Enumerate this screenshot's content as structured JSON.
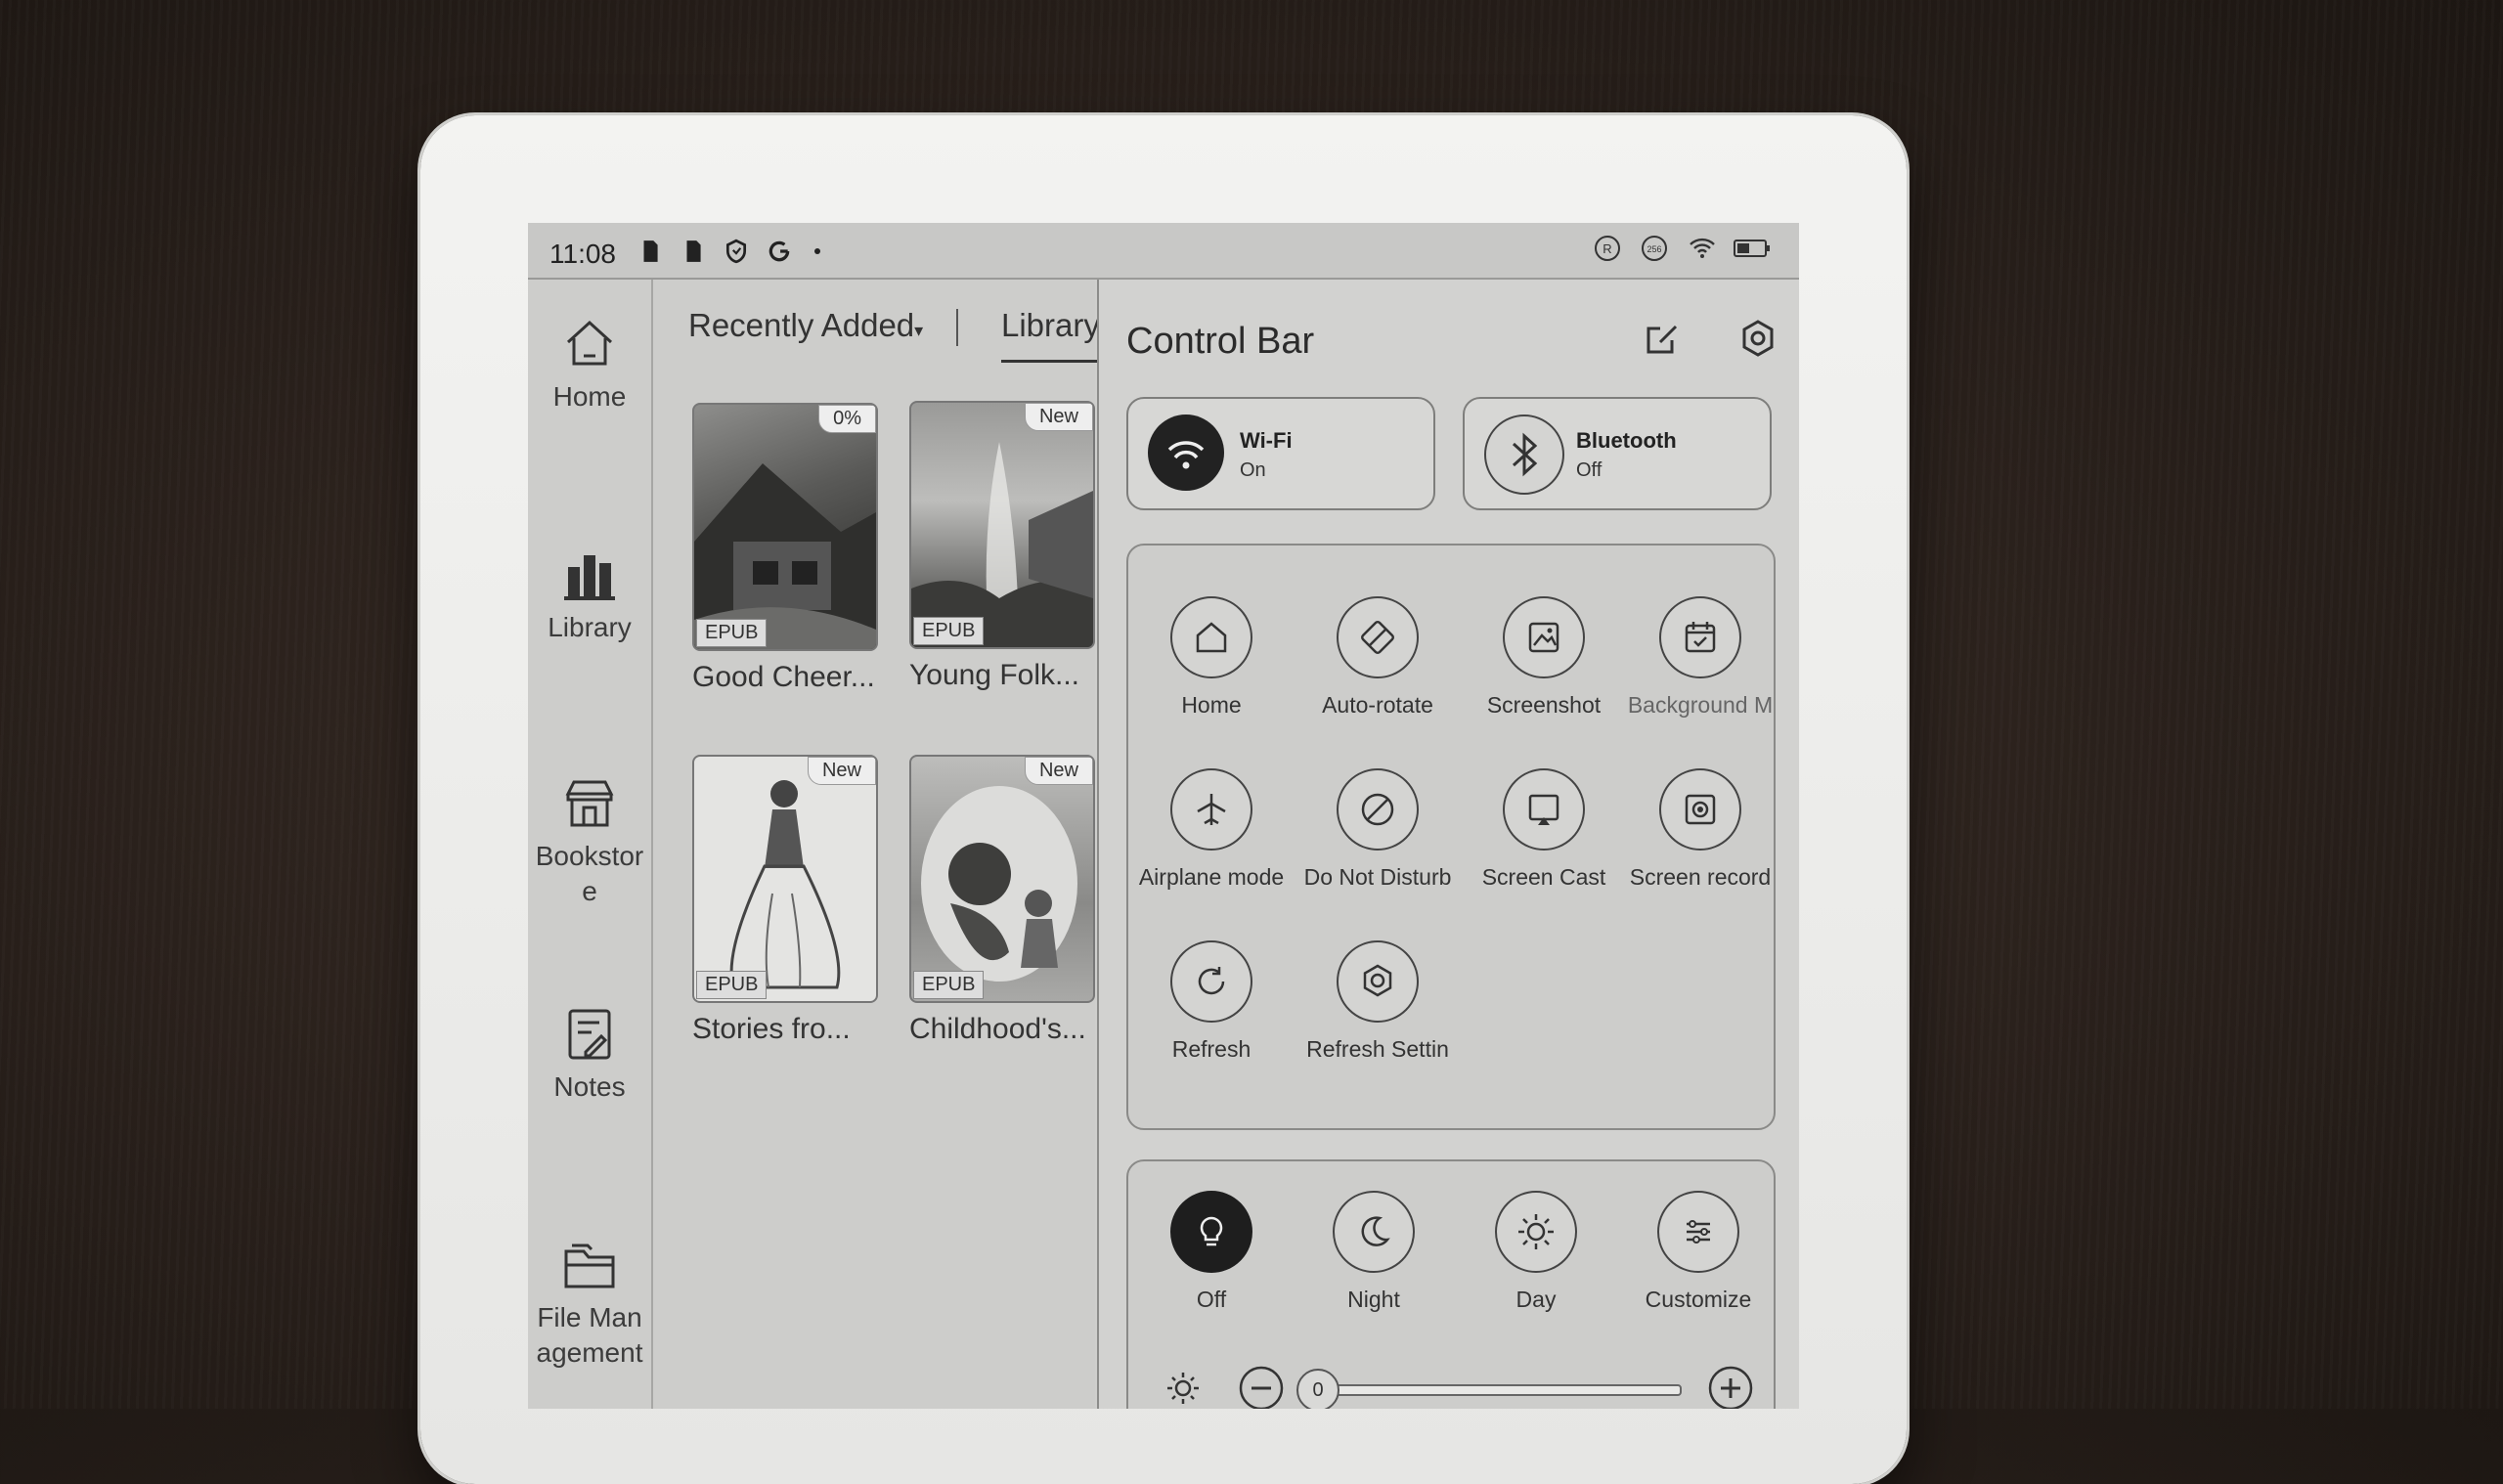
{
  "status_bar": {
    "time": "11:08",
    "icons": [
      "sd-card-icon",
      "sd-card-icon",
      "shield-icon",
      "google-icon",
      "dot-icon"
    ],
    "right_icons": [
      "r-icon",
      "256-icon",
      "wifi-icon",
      "battery-icon"
    ],
    "badge_256": "256",
    "badge_r": "R"
  },
  "nav": {
    "items": [
      {
        "label": "Home",
        "icon": "home-icon"
      },
      {
        "label": "Library",
        "icon": "library-icon"
      },
      {
        "label_line1": "Bookstor",
        "label_line2": "e",
        "icon": "store-icon"
      },
      {
        "label": "Notes",
        "icon": "notes-icon"
      },
      {
        "label_line1": "File Man",
        "label_line2": "agement",
        "icon": "folder-icon"
      }
    ]
  },
  "library": {
    "sort_label": "Recently Added",
    "tab_label": "Library",
    "books": [
      {
        "title": "Good Cheer...",
        "format": "EPUB",
        "badge": "0%"
      },
      {
        "title": "Young Folk...",
        "format": "EPUB",
        "badge": "New"
      },
      {
        "title": "Stories fro...",
        "format": "EPUB",
        "badge": "New"
      },
      {
        "title": "Childhood's...",
        "format": "EPUB",
        "badge": "New"
      }
    ]
  },
  "control_bar": {
    "title": "Control Bar",
    "wifi": {
      "name": "Wi-Fi",
      "state": "On"
    },
    "bluetooth": {
      "name": "Bluetooth",
      "state": "Off"
    },
    "quick_settings": [
      {
        "label": "Home",
        "icon": "home-icon"
      },
      {
        "label": "Auto-rotate",
        "icon": "rotate-icon"
      },
      {
        "label": "Screenshot",
        "icon": "screenshot-icon"
      },
      {
        "label": "Background M",
        "icon": "calendar-check-icon"
      },
      {
        "label": "Airplane mode",
        "icon": "airplane-icon"
      },
      {
        "label": "Do Not Disturb",
        "icon": "no-entry-icon"
      },
      {
        "label": "Screen Cast",
        "icon": "cast-icon"
      },
      {
        "label": "Screen record",
        "icon": "record-icon"
      },
      {
        "label": "Refresh",
        "icon": "refresh-icon"
      },
      {
        "label": "Refresh Settin",
        "icon": "refresh-settings-icon"
      }
    ],
    "light_modes": [
      {
        "label": "Off",
        "icon": "bulb-icon",
        "active": true
      },
      {
        "label": "Night",
        "icon": "moon-icon",
        "active": false
      },
      {
        "label": "Day",
        "icon": "sun-icon",
        "active": false
      },
      {
        "label": "Customize",
        "icon": "sliders-icon",
        "active": false
      }
    ],
    "brightness": {
      "value": "0"
    }
  }
}
